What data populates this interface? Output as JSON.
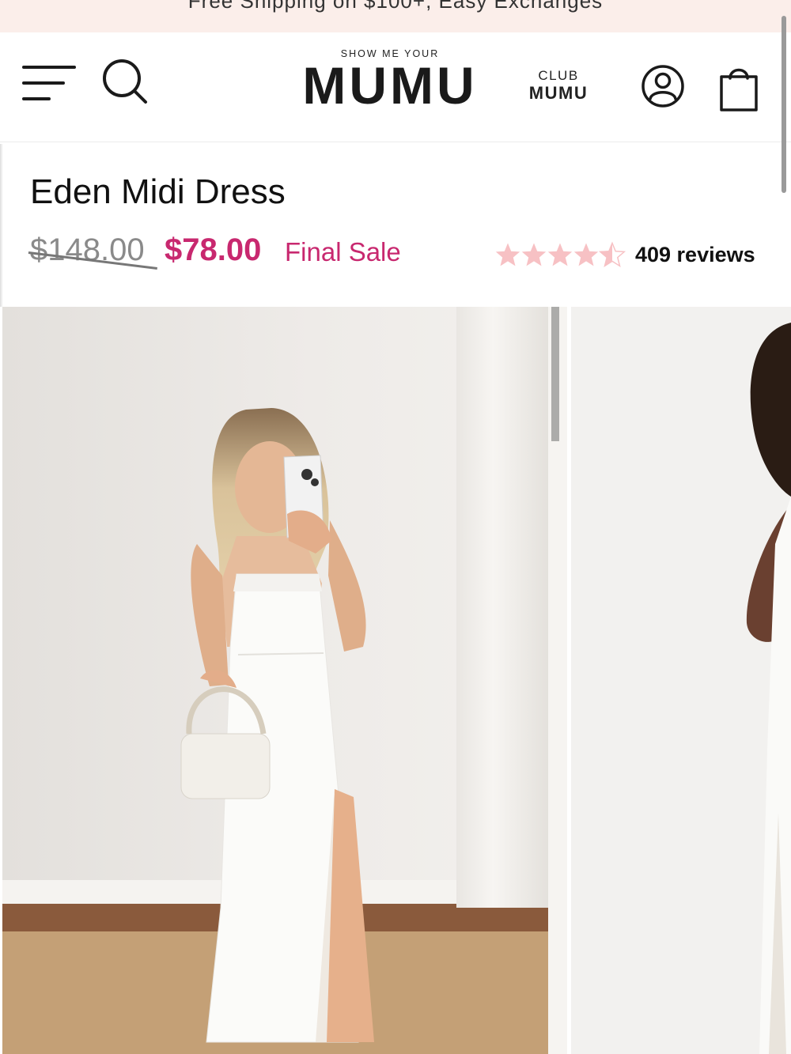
{
  "promo": {
    "text": "Free Shipping on $100+, Easy Exchanges"
  },
  "header": {
    "logo_tagline": "SHOW ME YOUR",
    "logo_brand": "MUMU",
    "club_top": "CLUB",
    "club_bottom": "MUMU",
    "icons": [
      "menu-icon",
      "search-icon",
      "account-icon",
      "cart-icon"
    ]
  },
  "product": {
    "title": "Eden Midi Dress",
    "original_price": "$148.00",
    "sale_price": "$78.00",
    "sale_label": "Final Sale",
    "rating": 4.5,
    "rating_max": 5,
    "review_count": "409 reviews"
  },
  "colors": {
    "accent_pink": "#c8286f",
    "star_pink": "#f7c1c4",
    "promo_bg": "#fbeeea"
  }
}
